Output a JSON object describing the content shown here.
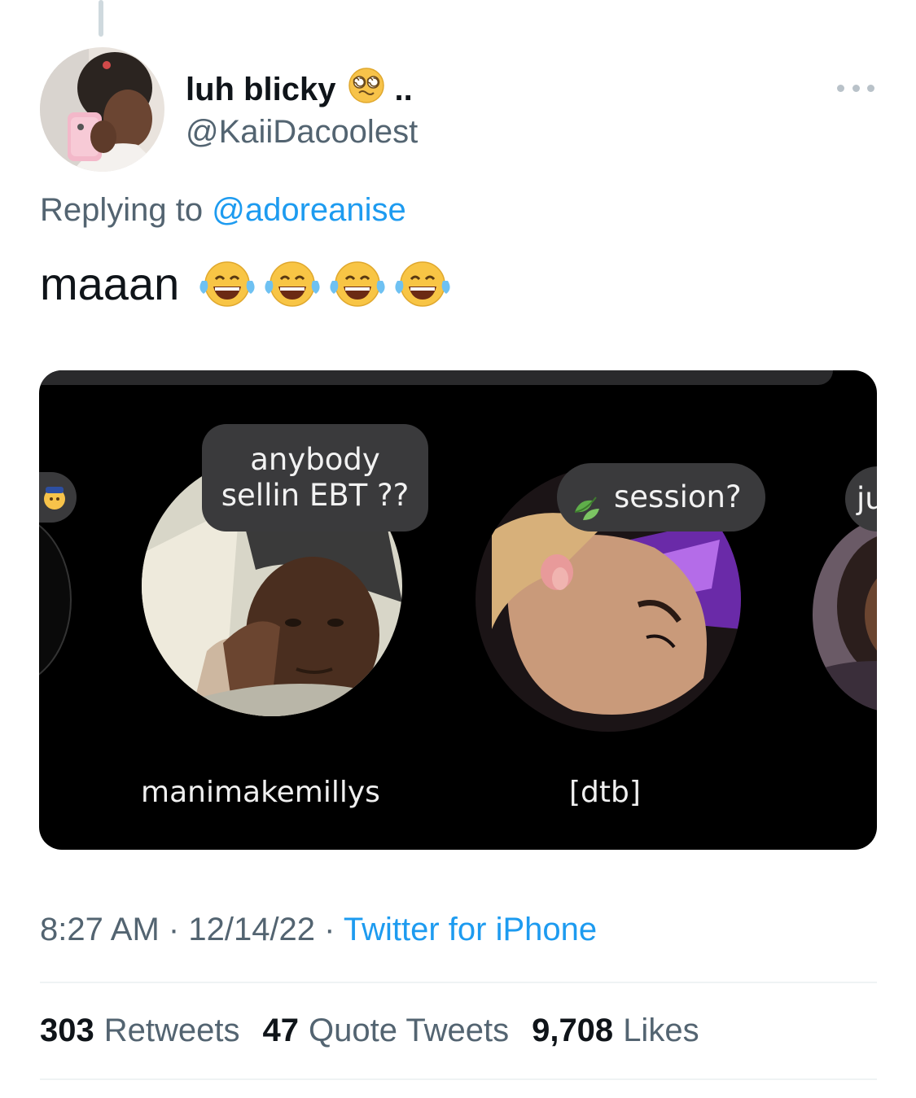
{
  "tweet": {
    "display_name": "luh blicky",
    "name_suffix": "..",
    "name_emoji": "dizzy-face-emoji",
    "handle": "@KaiiDacoolest",
    "replying_prefix": "Replying to",
    "replying_to": "@adoreanise",
    "text": "maaan",
    "text_emoji": "face-with-tears-of-joy-emoji",
    "text_emoji_count": 4
  },
  "media": {
    "notes": [
      {
        "line1": "anybody",
        "line2": "sellin EBT ??"
      },
      {
        "text": "session?",
        "icon": "leaf-emoji"
      },
      {
        "text": "ju"
      }
    ],
    "usernames": [
      "manimakemillys",
      "[dtb]"
    ]
  },
  "meta": {
    "time": "8:27 AM",
    "sep1": "·",
    "date": "12/14/22",
    "sep2": "·",
    "source": "Twitter for iPhone"
  },
  "stats": {
    "retweets": "303",
    "retweets_label": "Retweets",
    "quotes": "47",
    "quotes_label": "Quote Tweets",
    "likes": "9,708",
    "likes_label": "Likes"
  },
  "colors": {
    "link": "#1d9bf0",
    "secondary_text": "#536471",
    "primary_text": "#0f1419",
    "media_bg": "#000000"
  }
}
